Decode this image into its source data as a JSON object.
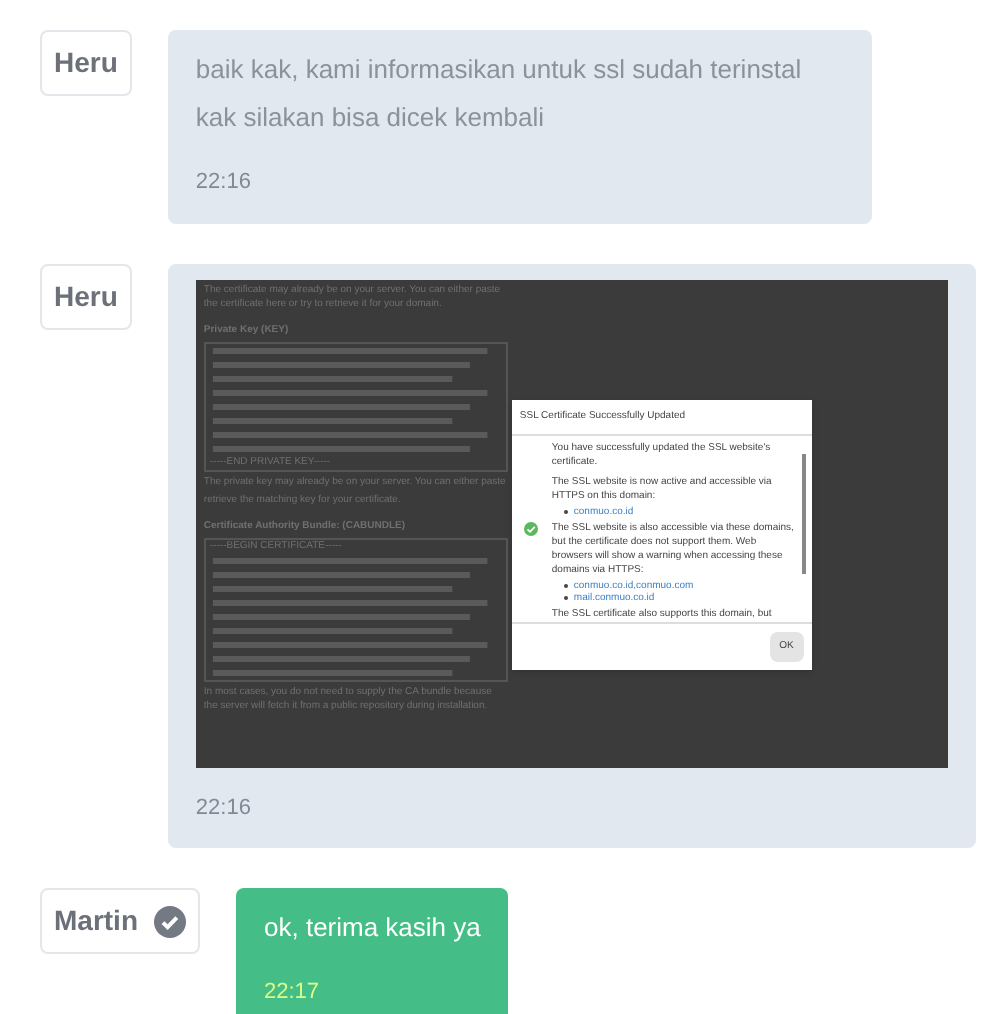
{
  "messages": [
    {
      "kind": "text",
      "sender": "Heru",
      "verified": false,
      "mine": false,
      "text": "baik kak, kami informasikan untuk ssl sudah terinstal kak silakan bisa dicek kembali",
      "time": "22:16"
    },
    {
      "kind": "screenshot",
      "sender": "Heru",
      "verified": false,
      "mine": false,
      "time": "22:16",
      "screenshot": {
        "intro": "The certificate may already be on your server. You can either paste the certificate here or try to retrieve it for your domain.",
        "key_label": "Private Key (KEY)",
        "key_end": "-----END PRIVATE KEY-----",
        "key_note": "The private key may already be on your server. You can either paste",
        "key_note_2": "retrieve the matching key for your certificate.",
        "bundle_label": "Certificate Authority Bundle: (CABUNDLE)",
        "bundle_begin": "-----BEGIN CERTIFICATE-----",
        "outro": "In most cases, you do not need to supply the CA bundle because the server will fetch it from a public repository during installation.",
        "dialog": {
          "title": "SSL Certificate Successfully Updated",
          "blocks": [
            {
              "kind": "text",
              "text": "You have successfully updated the SSL website's certificate."
            },
            {
              "kind": "text",
              "text": "The SSL website is now active and accessible via HTTPS on this domain:"
            },
            {
              "kind": "link",
              "text": "conmuo.co.id"
            },
            {
              "kind": "text",
              "text": "The SSL website is also accessible via these domains, but the certificate does not support them. Web browsers will show a warning when accessing these domains via HTTPS:"
            },
            {
              "kind": "link",
              "text": "conmuo.co.id,conmuo.com"
            },
            {
              "kind": "link",
              "text": "mail.conmuo.co.id"
            },
            {
              "kind": "text",
              "text": "The SSL certificate also supports this domain, but"
            }
          ],
          "button": "OK"
        }
      }
    },
    {
      "kind": "text",
      "sender": "Martin",
      "verified": true,
      "mine": true,
      "text": "ok, terima kasih ya",
      "time": "22:17"
    }
  ]
}
